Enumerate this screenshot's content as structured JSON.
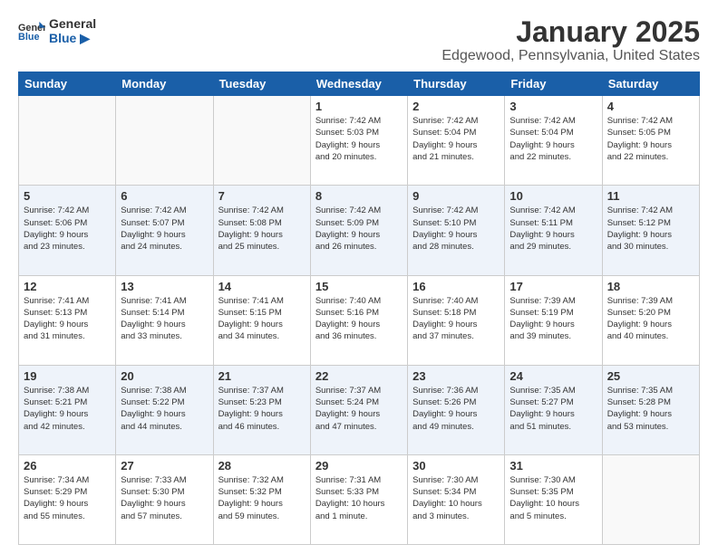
{
  "header": {
    "logo_line1": "General",
    "logo_line2": "Blue",
    "title": "January 2025",
    "subtitle": "Edgewood, Pennsylvania, United States"
  },
  "days_of_week": [
    "Sunday",
    "Monday",
    "Tuesday",
    "Wednesday",
    "Thursday",
    "Friday",
    "Saturday"
  ],
  "weeks": [
    [
      {
        "day": "",
        "info": ""
      },
      {
        "day": "",
        "info": ""
      },
      {
        "day": "",
        "info": ""
      },
      {
        "day": "1",
        "info": "Sunrise: 7:42 AM\nSunset: 5:03 PM\nDaylight: 9 hours\nand 20 minutes."
      },
      {
        "day": "2",
        "info": "Sunrise: 7:42 AM\nSunset: 5:04 PM\nDaylight: 9 hours\nand 21 minutes."
      },
      {
        "day": "3",
        "info": "Sunrise: 7:42 AM\nSunset: 5:04 PM\nDaylight: 9 hours\nand 22 minutes."
      },
      {
        "day": "4",
        "info": "Sunrise: 7:42 AM\nSunset: 5:05 PM\nDaylight: 9 hours\nand 22 minutes."
      }
    ],
    [
      {
        "day": "5",
        "info": "Sunrise: 7:42 AM\nSunset: 5:06 PM\nDaylight: 9 hours\nand 23 minutes."
      },
      {
        "day": "6",
        "info": "Sunrise: 7:42 AM\nSunset: 5:07 PM\nDaylight: 9 hours\nand 24 minutes."
      },
      {
        "day": "7",
        "info": "Sunrise: 7:42 AM\nSunset: 5:08 PM\nDaylight: 9 hours\nand 25 minutes."
      },
      {
        "day": "8",
        "info": "Sunrise: 7:42 AM\nSunset: 5:09 PM\nDaylight: 9 hours\nand 26 minutes."
      },
      {
        "day": "9",
        "info": "Sunrise: 7:42 AM\nSunset: 5:10 PM\nDaylight: 9 hours\nand 28 minutes."
      },
      {
        "day": "10",
        "info": "Sunrise: 7:42 AM\nSunset: 5:11 PM\nDaylight: 9 hours\nand 29 minutes."
      },
      {
        "day": "11",
        "info": "Sunrise: 7:42 AM\nSunset: 5:12 PM\nDaylight: 9 hours\nand 30 minutes."
      }
    ],
    [
      {
        "day": "12",
        "info": "Sunrise: 7:41 AM\nSunset: 5:13 PM\nDaylight: 9 hours\nand 31 minutes."
      },
      {
        "day": "13",
        "info": "Sunrise: 7:41 AM\nSunset: 5:14 PM\nDaylight: 9 hours\nand 33 minutes."
      },
      {
        "day": "14",
        "info": "Sunrise: 7:41 AM\nSunset: 5:15 PM\nDaylight: 9 hours\nand 34 minutes."
      },
      {
        "day": "15",
        "info": "Sunrise: 7:40 AM\nSunset: 5:16 PM\nDaylight: 9 hours\nand 36 minutes."
      },
      {
        "day": "16",
        "info": "Sunrise: 7:40 AM\nSunset: 5:18 PM\nDaylight: 9 hours\nand 37 minutes."
      },
      {
        "day": "17",
        "info": "Sunrise: 7:39 AM\nSunset: 5:19 PM\nDaylight: 9 hours\nand 39 minutes."
      },
      {
        "day": "18",
        "info": "Sunrise: 7:39 AM\nSunset: 5:20 PM\nDaylight: 9 hours\nand 40 minutes."
      }
    ],
    [
      {
        "day": "19",
        "info": "Sunrise: 7:38 AM\nSunset: 5:21 PM\nDaylight: 9 hours\nand 42 minutes."
      },
      {
        "day": "20",
        "info": "Sunrise: 7:38 AM\nSunset: 5:22 PM\nDaylight: 9 hours\nand 44 minutes."
      },
      {
        "day": "21",
        "info": "Sunrise: 7:37 AM\nSunset: 5:23 PM\nDaylight: 9 hours\nand 46 minutes."
      },
      {
        "day": "22",
        "info": "Sunrise: 7:37 AM\nSunset: 5:24 PM\nDaylight: 9 hours\nand 47 minutes."
      },
      {
        "day": "23",
        "info": "Sunrise: 7:36 AM\nSunset: 5:26 PM\nDaylight: 9 hours\nand 49 minutes."
      },
      {
        "day": "24",
        "info": "Sunrise: 7:35 AM\nSunset: 5:27 PM\nDaylight: 9 hours\nand 51 minutes."
      },
      {
        "day": "25",
        "info": "Sunrise: 7:35 AM\nSunset: 5:28 PM\nDaylight: 9 hours\nand 53 minutes."
      }
    ],
    [
      {
        "day": "26",
        "info": "Sunrise: 7:34 AM\nSunset: 5:29 PM\nDaylight: 9 hours\nand 55 minutes."
      },
      {
        "day": "27",
        "info": "Sunrise: 7:33 AM\nSunset: 5:30 PM\nDaylight: 9 hours\nand 57 minutes."
      },
      {
        "day": "28",
        "info": "Sunrise: 7:32 AM\nSunset: 5:32 PM\nDaylight: 9 hours\nand 59 minutes."
      },
      {
        "day": "29",
        "info": "Sunrise: 7:31 AM\nSunset: 5:33 PM\nDaylight: 10 hours\nand 1 minute."
      },
      {
        "day": "30",
        "info": "Sunrise: 7:30 AM\nSunset: 5:34 PM\nDaylight: 10 hours\nand 3 minutes."
      },
      {
        "day": "31",
        "info": "Sunrise: 7:30 AM\nSunset: 5:35 PM\nDaylight: 10 hours\nand 5 minutes."
      },
      {
        "day": "",
        "info": ""
      }
    ]
  ]
}
